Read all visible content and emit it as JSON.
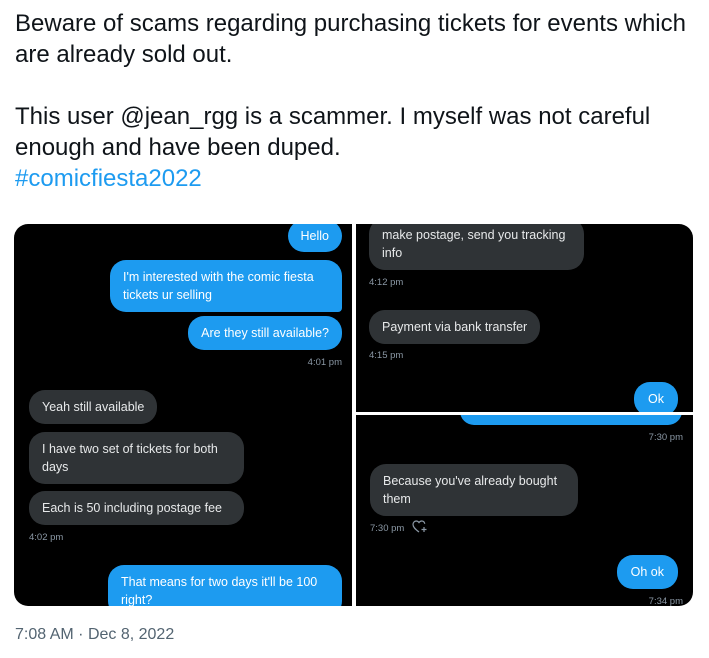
{
  "tweet": {
    "line1": "Beware of scams regarding purchasing tickets for events which are already sold out.",
    "line2": "This user @jean_rgg is a scammer. I myself was not careful enough and have been duped.",
    "hashtag": "#comicfiesta2022",
    "timestamp": "7:08 AM",
    "separator": "·",
    "date": "Dec 8, 2022"
  },
  "screenshot1": {
    "messages": [
      {
        "text": "Hello",
        "dir": "out"
      },
      {
        "text": "I'm interested with the comic fiesta tickets ur selling",
        "dir": "out"
      },
      {
        "text": "Are they still available?",
        "dir": "out"
      },
      {
        "text": "Yeah still available",
        "dir": "in"
      },
      {
        "text": "I have two set of tickets for both days",
        "dir": "in"
      },
      {
        "text": "Each is 50 including postage fee",
        "dir": "in"
      },
      {
        "text": "That means for two days it'll be 100 right?",
        "dir": "out"
      }
    ],
    "time1": "4:01 pm",
    "time2": "4:02 pm"
  },
  "screenshot2": {
    "messages": [
      {
        "text": "make postage, send you tracking info",
        "dir": "in"
      },
      {
        "text": "Payment via bank transfer",
        "dir": "in"
      },
      {
        "text": "Ok",
        "dir": "out"
      }
    ],
    "time1": "4:12 pm",
    "time2": "4:15 pm"
  },
  "screenshot3": {
    "messages": [
      {
        "text": "Because you've already bought them",
        "dir": "in"
      },
      {
        "text": "Oh ok",
        "dir": "out"
      }
    ],
    "time1": "7:30 pm",
    "time2": "7:30 pm",
    "time3": "7:34 pm"
  },
  "icons": {
    "reaction": "heart-plus-icon"
  }
}
